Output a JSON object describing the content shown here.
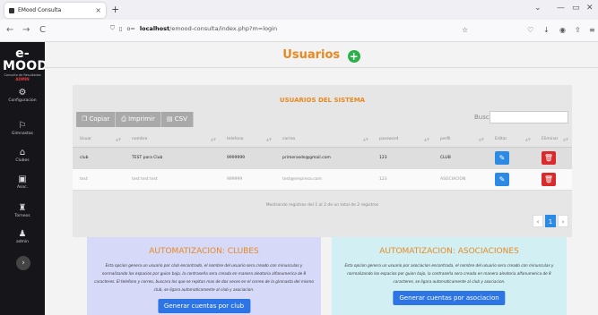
{
  "browser": {
    "tab_title": "EMood Consulta",
    "tab_close": "×",
    "new_tab": "+",
    "url_host": "localhost",
    "url_path": "/emood-consulta/index.php?m=login",
    "url_prefix": "o=",
    "back": "←",
    "forward": "→",
    "reload": "C",
    "star": "☆"
  },
  "sidebar": {
    "logo": "e-MOOD",
    "logo_sub": "Consulta de Resultados",
    "admin_tag": "ADMIN",
    "items": [
      {
        "label": "Configuracion",
        "icon": "⚙"
      },
      {
        "label": "Gimnastas",
        "icon": "⚐"
      },
      {
        "label": "Clubes",
        "icon": "⌂"
      },
      {
        "label": "Asoc.",
        "icon": "▣"
      },
      {
        "label": "Torneos",
        "icon": "♜"
      },
      {
        "label": "admin",
        "icon": "♟"
      }
    ],
    "toggle": "›"
  },
  "page": {
    "title": "Usuarios",
    "add_icon": "+"
  },
  "panel": {
    "title": "USUARIOS DEL SISTEMA",
    "buttons": [
      {
        "label": "Copiar",
        "icon": "❐"
      },
      {
        "label": "Imprimir",
        "icon": "⎙"
      },
      {
        "label": "CSV",
        "icon": "▤"
      }
    ],
    "search_label": "Buscar:",
    "search_value": "",
    "columns": [
      "Usuar",
      "nombre",
      "telefono",
      "correo",
      "password",
      "perfil",
      "Editar",
      "Eliminar"
    ],
    "rows": [
      {
        "usuario": "club",
        "nombre": "TEST para Club",
        "telefono": "9999999",
        "correo": "primerasde@gmail.com",
        "password": "123",
        "perfil": "CLUB"
      },
      {
        "usuario": "test",
        "nombre": "test test test",
        "telefono": "999999",
        "correo": "test@empresa.com",
        "password": "123",
        "perfil": "ASOCIACION"
      }
    ],
    "info": "Mostrando registros del 1 al 2 de un total de 2 registros",
    "pager": {
      "prev": "‹",
      "current": "1",
      "next": "›"
    }
  },
  "clubes": {
    "title": "AUTOMATIZACION: CLUBES",
    "text": "Esta opcion genera un usuario por club encontrado, el nombre del usuario sera creado con minusculas y normalizando los espacios por guion bajo, la contraseña sera creada en manera aleatoria alfanumerica de 8 caracteres. El telefono y correo, buscara los que se repitan mas de dos veces en el correo de la gimnasta del mismo club, se ligara automaticamente al club y asociacion.",
    "button": "Generar cuentas por club"
  },
  "asociaciones": {
    "title": "AUTOMATIZACION: ASOCIACIONES",
    "text": "Esta opcion genera un usuario por asociacion encontrada, el nombre del usuario sera creado con minusculas y normalizando los espacios por guion bajo, la contraseña sera creada en manera aleatoria alfanumerica de 8 caracteres, se ligara automaticamente al club y asociacion.",
    "button": "Generar cuentas por asociacion"
  }
}
